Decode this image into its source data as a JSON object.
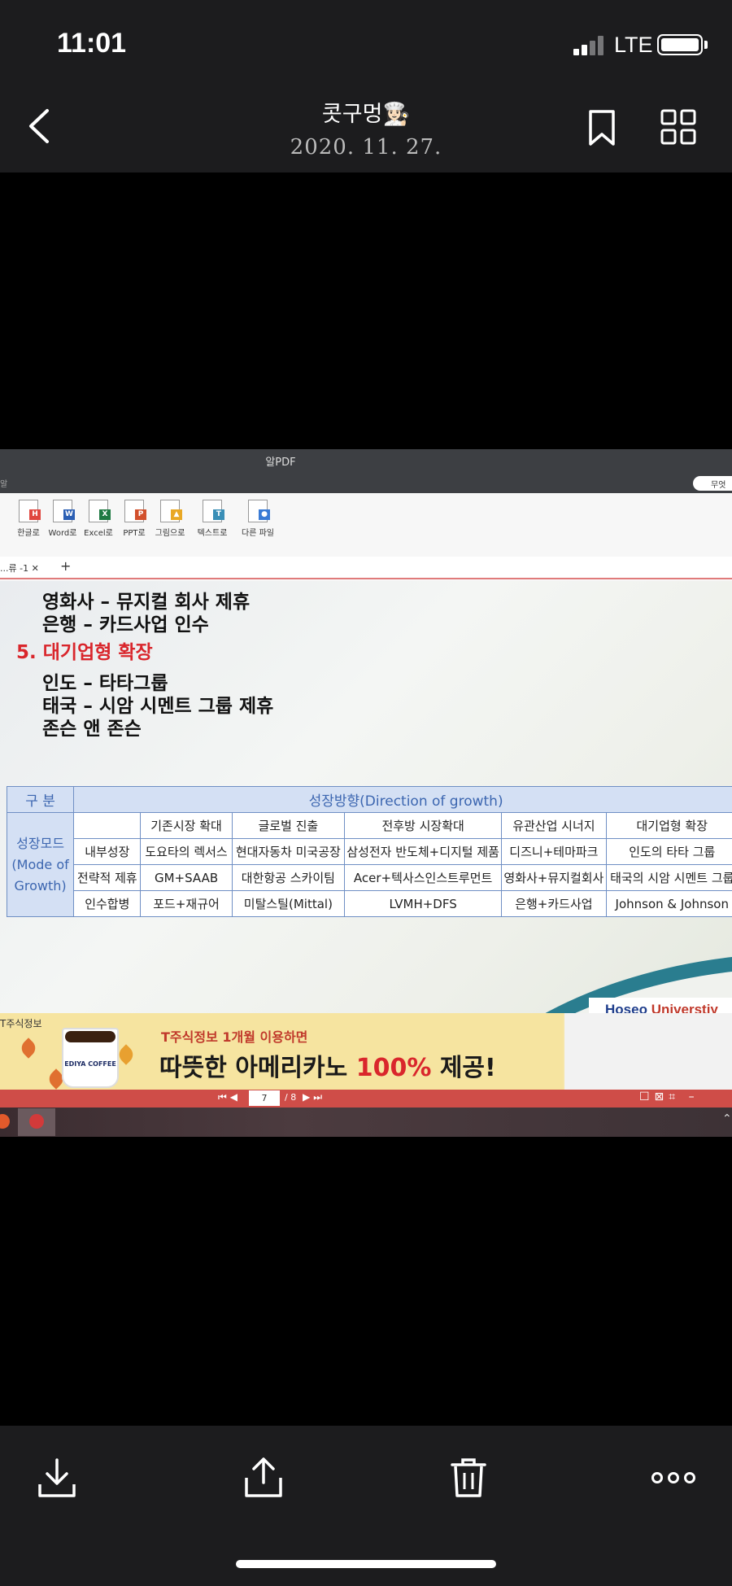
{
  "status": {
    "time": "11:01",
    "network": "LTE"
  },
  "header": {
    "title": "콧구멍👩🏻‍🍳",
    "date": "2020. 11. 27."
  },
  "screenshot": {
    "app_title": "알PDF",
    "app_left": "알",
    "search_text": "무엇",
    "toolbar": [
      {
        "label": "한글로",
        "letter": "H",
        "color": "#e0463f"
      },
      {
        "label": "Word로",
        "letter": "W",
        "color": "#2b5fb4"
      },
      {
        "label": "Excel로",
        "letter": "X",
        "color": "#1f7a43"
      },
      {
        "label": "PPT로",
        "letter": "P",
        "color": "#d2502c"
      },
      {
        "label": "그림으로",
        "letter": "▲",
        "color": "#e9a825"
      },
      {
        "label": "텍스트로",
        "letter": "T",
        "color": "#3a8fb7"
      },
      {
        "label": "다른 파일",
        "letter": "●",
        "color": "#3a7bd5"
      }
    ],
    "tab_label": "...류 -1",
    "slide_lines": [
      "영화사 – 뮤지컬 회사 제휴",
      "은행 – 카드사업 인수",
      "5. 대기업형 확장",
      "인도 – 타타그룹",
      "태국 – 시암 시멘트 그룹 제휴",
      "존슨 앤 존슨"
    ],
    "table": {
      "corner": "구  분",
      "direction": "성장방향(Direction of growth)",
      "mode_label": "성장모드 (Mode of Growth)",
      "columns": [
        "기존시장 확대",
        "글로벌 진출",
        "전후방 시장확대",
        "유관산업 시너지",
        "대기업형 확장"
      ],
      "rows": [
        {
          "label": "내부성장",
          "cells": [
            "도요타의 렉서스",
            "현대자동차 미국공장",
            "삼성전자 반도체+디지털 제품",
            "디즈니+테마파크",
            "인도의 타타 그룹"
          ]
        },
        {
          "label": "전략적 제휴",
          "cells": [
            "GM+SAAB",
            "대한항공 스카이팀",
            "Acer+텍사스인스트루먼트",
            "영화사+뮤지컬회사",
            "태국의 시암 시멘트 그룹"
          ]
        },
        {
          "label": "인수합병",
          "cells": [
            "포드+재규어",
            "미탈스틸(Mittal)",
            "LVMH+DFS",
            "은행+카드사업",
            "Johnson & Johnson"
          ]
        }
      ]
    },
    "university": {
      "part1": "Hoseo ",
      "part2": "Universtiy"
    },
    "ad": {
      "label": "T주식정보",
      "cup_brand": "EDIYA COFFEE",
      "line1": "T주식정보 1개월 이용하면",
      "line2_a": "따뜻한 아메리카노 ",
      "line2_b": "100%",
      "line2_c": " 제공!"
    },
    "pagebar": {
      "current": "7",
      "total": "/ 8"
    }
  },
  "colors": {
    "bar": "#1c1c1e",
    "accent_red": "#d9262c",
    "table_border": "#6f8fc4"
  }
}
